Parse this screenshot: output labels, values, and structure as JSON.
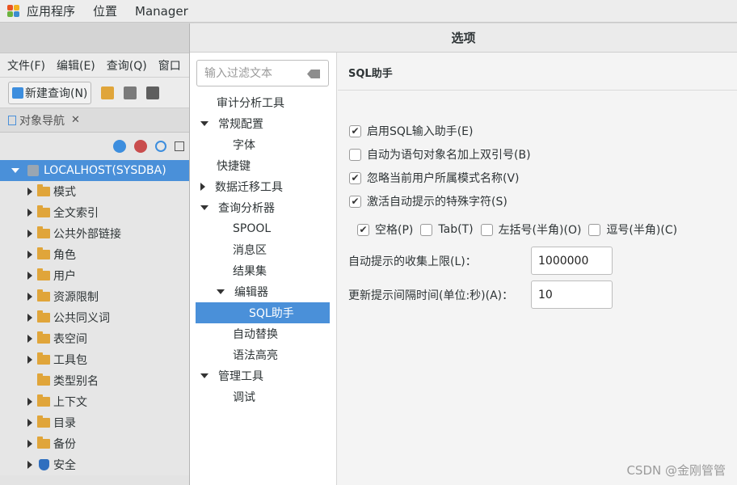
{
  "topbar": {
    "items": [
      "应用程序",
      "位置",
      "Manager"
    ]
  },
  "mainwin": {
    "menu": [
      "文件(F)",
      "编辑(E)",
      "查询(Q)",
      "窗口"
    ],
    "toolbar": {
      "new_query": "新建查询(N)"
    },
    "nav_tab": "对象导航",
    "tree": {
      "root": "LOCALHOST(SYSDBA)",
      "items": [
        "模式",
        "全文索引",
        "公共外部链接",
        "角色",
        "用户",
        "资源限制",
        "公共同义词",
        "表空间",
        "工具包",
        "类型别名",
        "上下文",
        "目录",
        "备份",
        "安全"
      ]
    }
  },
  "dialog": {
    "title": "选项",
    "filter_placeholder": "输入过滤文本",
    "tree": [
      "审计分析工具",
      "常规配置",
      "字体",
      "快捷键",
      "数据迁移工具",
      "查询分析器",
      "SPOOL",
      "消息区",
      "结果集",
      "编辑器",
      "SQL助手",
      "自动替换",
      "语法高亮",
      "管理工具",
      "调试"
    ],
    "section_title": "SQL助手",
    "options": [
      {
        "label": "启用SQL输入助手(E)",
        "checked": true
      },
      {
        "label": "自动为语句对象名加上双引号(B)",
        "checked": false
      },
      {
        "label": "忽略当前用户所属模式名称(V)",
        "checked": true
      },
      {
        "label": "激活自动提示的特殊字符(S)",
        "checked": true
      }
    ],
    "special_chars": [
      {
        "label": "空格(P)",
        "checked": true
      },
      {
        "label": "Tab(T)",
        "checked": false
      },
      {
        "label": "左括号(半角)(O)",
        "checked": false
      },
      {
        "label": "逗号(半角)(C)",
        "checked": false
      }
    ],
    "limit_label": "自动提示的收集上限(L)：",
    "limit_value": "1000000",
    "interval_label": "更新提示间隔时间(单位:秒)(A)：",
    "interval_value": "10"
  },
  "watermark": "CSDN @金刚管管"
}
